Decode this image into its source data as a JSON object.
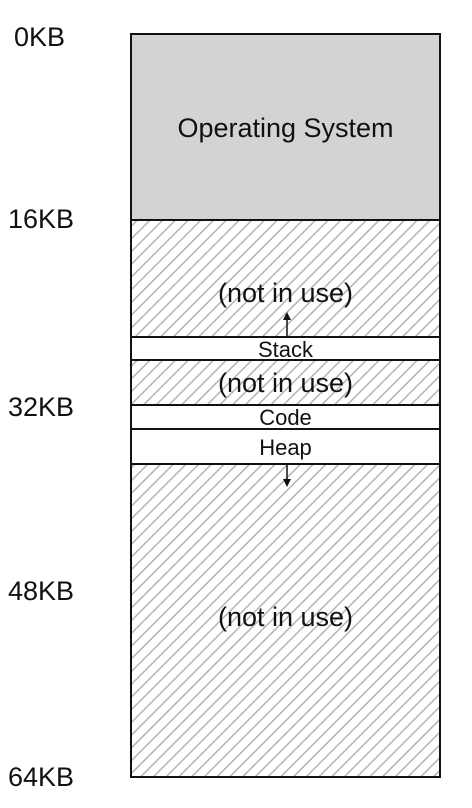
{
  "address_labels": {
    "kb0": "0KB",
    "kb16": "16KB",
    "kb32": "32KB",
    "kb48": "48KB",
    "kb64": "64KB"
  },
  "regions": {
    "os": "Operating System",
    "free_top": "(not in use)",
    "stack": "Stack",
    "free_middle": "(not in use)",
    "code": "Code",
    "heap": "Heap",
    "free_bottom": "(not in use)"
  },
  "colors": {
    "os_fill": "#d3d3d3",
    "hatch": "#b4b4b4",
    "line": "#111111",
    "background": "#ffffff"
  },
  "icons": {
    "stack_growth": "arrow-up-icon",
    "heap_growth": "arrow-down-icon"
  }
}
